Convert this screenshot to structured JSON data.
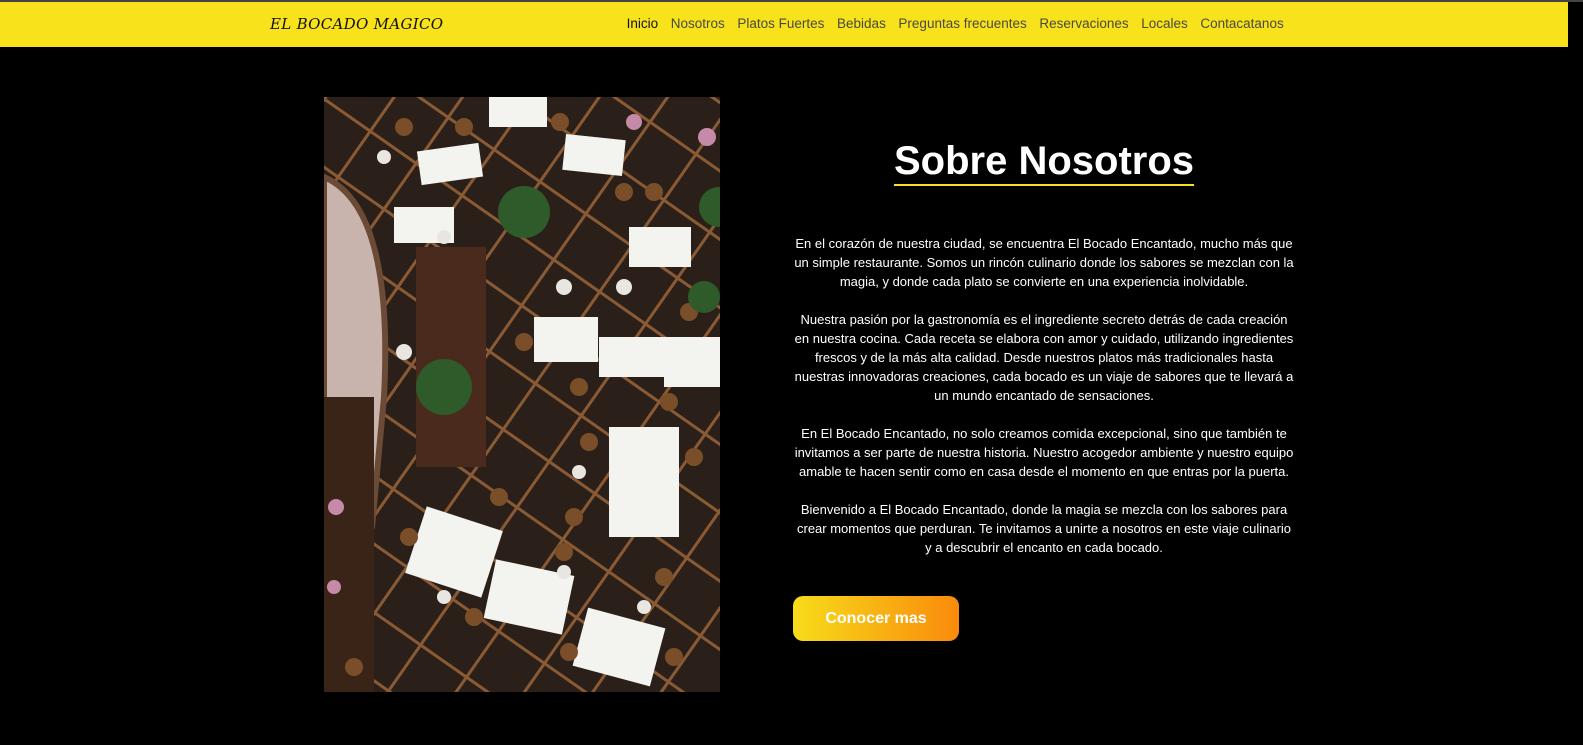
{
  "brand": "EL BOCADO MAGICO",
  "nav": {
    "items": [
      "Inicio",
      "Nosotros",
      "Platos Fuertes",
      "Bebidas",
      "Preguntas frecuentes",
      "Reservaciones",
      "Locales",
      "Contacatanos"
    ],
    "active": "Inicio"
  },
  "colors": {
    "nav_bg": "#f8e21c",
    "page_bg": "#000000",
    "accent": "#f8e21c",
    "button_gradient_start": "#f7dc1a",
    "button_gradient_end": "#fa8a0c"
  },
  "about": {
    "title": "Sobre Nosotros",
    "paragraphs": [
      "En el corazón de nuestra ciudad, se encuentra El Bocado Encantado, mucho más que un simple restaurante. Somos un rincón culinario donde los sabores se mezclan con la magia, y donde cada plato se convierte en una experiencia inolvidable.",
      "Nuestra pasión por la gastronomía es el ingrediente secreto detrás de cada creación en nuestra cocina. Cada receta se elabora con amor y cuidado, utilizando ingredientes frescos y de la más alta calidad. Desde nuestros platos más tradicionales hasta nuestras innovadoras creaciones, cada bocado es un viaje de sabores que te llevará a un mundo encantado de sensaciones.",
      "En El Bocado Encantado, no solo creamos comida excepcional, sino que también te invitamos a ser parte de nuestra historia. Nuestro acogedor ambiente y nuestro equipo amable te hacen sentir como en casa desde el momento en que entras por la puerta.",
      "Bienvenido a El Bocado Encantado, donde la magia se mezcla con los sabores para crear momentos que perduran. Te invitamos a unirte a nosotros en este viaje culinario y a descubrir el encanto en cada bocado."
    ],
    "button_label": "Conocer mas"
  }
}
